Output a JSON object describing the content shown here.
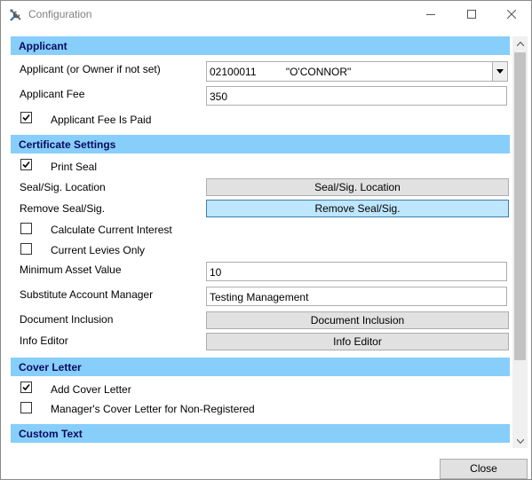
{
  "window": {
    "title": "Configuration"
  },
  "applicant": {
    "header": "Applicant",
    "applicant_label": "Applicant (or Owner if not set)",
    "applicant_value": "02100011          \"O'CONNOR\"",
    "fee_label": "Applicant Fee",
    "fee_value": "350",
    "fee_paid_label": "Applicant Fee Is Paid",
    "fee_paid_checked": true
  },
  "certificate": {
    "header": "Certificate Settings",
    "print_seal_label": "Print Seal",
    "print_seal_checked": true,
    "seal_location_label": "Seal/Sig. Location",
    "seal_location_button": "Seal/Sig. Location",
    "remove_seal_label": "Remove Seal/Sig.",
    "remove_seal_button": "Remove Seal/Sig.",
    "calc_interest_label": "Calculate Current Interest",
    "calc_interest_checked": false,
    "current_levies_label": "Current Levies Only",
    "current_levies_checked": false,
    "min_asset_label": "Minimum Asset Value",
    "min_asset_value": "10",
    "sub_manager_label": "Substitute Account Manager",
    "sub_manager_value": "Testing Management",
    "doc_inclusion_label": "Document Inclusion",
    "doc_inclusion_button": "Document Inclusion",
    "info_editor_label": "Info Editor",
    "info_editor_button": "Info Editor"
  },
  "cover_letter": {
    "header": "Cover Letter",
    "add_cover_label": "Add Cover Letter",
    "add_cover_checked": true,
    "manager_cover_label": "Manager's Cover Letter for Non-Registered",
    "manager_cover_checked": false
  },
  "custom_text": {
    "header": "Custom Text"
  },
  "footer": {
    "close_label": "Close"
  },
  "colors": {
    "section_bg": "#87cefa",
    "section_text": "#0b0b5f",
    "button_bg": "#e1e1e1",
    "button_hover_bg": "#bee6fd"
  }
}
